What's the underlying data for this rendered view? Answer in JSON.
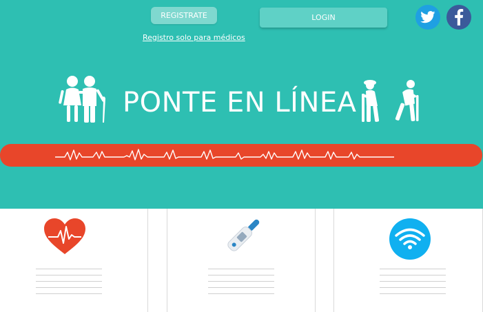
{
  "header": {
    "register_label": "REGISTRATE",
    "login_label": "LOGIN",
    "doctors_link": "Registro solo para médicos"
  },
  "social": [
    {
      "name": "twitter",
      "icon": "twitter-icon",
      "color": "#1fa0e2"
    },
    {
      "name": "facebook",
      "icon": "facebook-icon",
      "color": "#3b5a9a"
    }
  ],
  "hero": {
    "title": "PONTE EN LÍNEA",
    "left_icon": "elderly-couple-icon",
    "right_icon": "elderly-walkers-icon",
    "banner_icon": "heartbeat-pulse-icon"
  },
  "features": [
    {
      "icon": "heart-pulse-icon"
    },
    {
      "icon": "thermometer-icon"
    },
    {
      "icon": "wifi-icon"
    }
  ],
  "colors": {
    "hero_bg": "#2ebfb2",
    "band": "#e8462a",
    "heart": "#e8462a",
    "wifi": "#10b0f0"
  }
}
